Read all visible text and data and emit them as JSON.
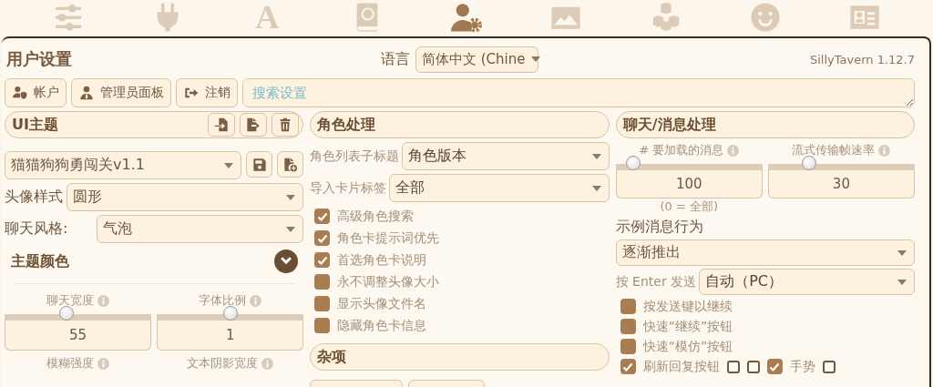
{
  "nav": [
    {
      "kind": "sliders",
      "selected": false
    },
    {
      "kind": "plug",
      "selected": false
    },
    {
      "kind": "font",
      "glyph": "A",
      "selected": false
    },
    {
      "kind": "book",
      "selected": false
    },
    {
      "kind": "user-gear",
      "selected": true
    },
    {
      "kind": "image",
      "selected": false
    },
    {
      "kind": "cubes",
      "selected": false
    },
    {
      "kind": "smiley",
      "selected": false
    },
    {
      "kind": "id-card",
      "selected": false
    }
  ],
  "header": {
    "title": "用户设置",
    "language_label": "语言",
    "language_value": "简体中文 (Chine",
    "version": "SillyTavern 1.12.7"
  },
  "toolbar": {
    "buttons": [
      {
        "kind": "account",
        "label": "帐户"
      },
      {
        "kind": "admin",
        "label": "管理员面板"
      },
      {
        "kind": "logout",
        "label": "注销"
      }
    ],
    "search": {
      "placeholder": "搜索设置"
    }
  },
  "ui_theme": {
    "title": "UI主题",
    "actions": [
      {
        "kind": "import"
      },
      {
        "kind": "export"
      },
      {
        "kind": "delete"
      }
    ],
    "preset": "猫猫狗狗勇闯关v1.1",
    "preset_actions": [
      {
        "kind": "save"
      },
      {
        "kind": "new"
      }
    ],
    "fields": [
      {
        "label": "头像样式",
        "value": "圆形",
        "kind": "wide"
      },
      {
        "label": "聊天风格:",
        "value": "气泡",
        "kind": "narrow"
      }
    ],
    "theme_colors": {
      "title": "主题颜色"
    },
    "sliders": [
      {
        "label": "聊天宽度",
        "value": "55",
        "level": 0.42
      },
      {
        "label": "字体比例",
        "value": "1",
        "level": 0.5
      }
    ],
    "more_labels": [
      "模糊强度",
      "文本阴影宽度"
    ]
  },
  "character_handling": {
    "title": "角色处理",
    "fields": [
      {
        "label": "角色列表子标题",
        "value": "角色版本"
      },
      {
        "label": "导入卡片标签",
        "value": "全部"
      }
    ],
    "options": [
      {
        "label": "高级角色搜索",
        "checked": true
      },
      {
        "label": "角色卡提示词优先",
        "checked": true
      },
      {
        "label": "首选角色卡说明",
        "checked": true
      },
      {
        "label": "永不调整头像大小",
        "checked": false
      },
      {
        "label": "显示头像文件名",
        "checked": false
      },
      {
        "label": "隐藏角色卡信息",
        "checked": false
      }
    ]
  },
  "misc": {
    "title": "杂项"
  },
  "chat_handling": {
    "title": "聊天/消息处理",
    "sliders": [
      {
        "label": "# 要加载的消息",
        "value": "100",
        "level": 0.12,
        "note": "(0 = 全部)"
      },
      {
        "label": "流式传输帧速率",
        "value": "30",
        "level": 0.28
      }
    ],
    "example_behavior": {
      "label": "示例消息行为",
      "value": "逐渐推出"
    },
    "send_on_enter": {
      "label": "按 Enter 发送",
      "value": "自动（PC）"
    },
    "options": [
      {
        "label": "按发送键以继续",
        "checked": false
      },
      {
        "label": "快速“继续”按钮",
        "checked": false
      },
      {
        "label": "快速“模仿”按钮",
        "checked": false
      }
    ],
    "last_row": [
      {
        "kind": "check",
        "label": "刷新回复按钮",
        "checked": true
      },
      {
        "kind": "box"
      },
      {
        "kind": "box"
      },
      {
        "kind": "check",
        "label": "手势",
        "checked": true
      },
      {
        "kind": "box"
      }
    ]
  }
}
